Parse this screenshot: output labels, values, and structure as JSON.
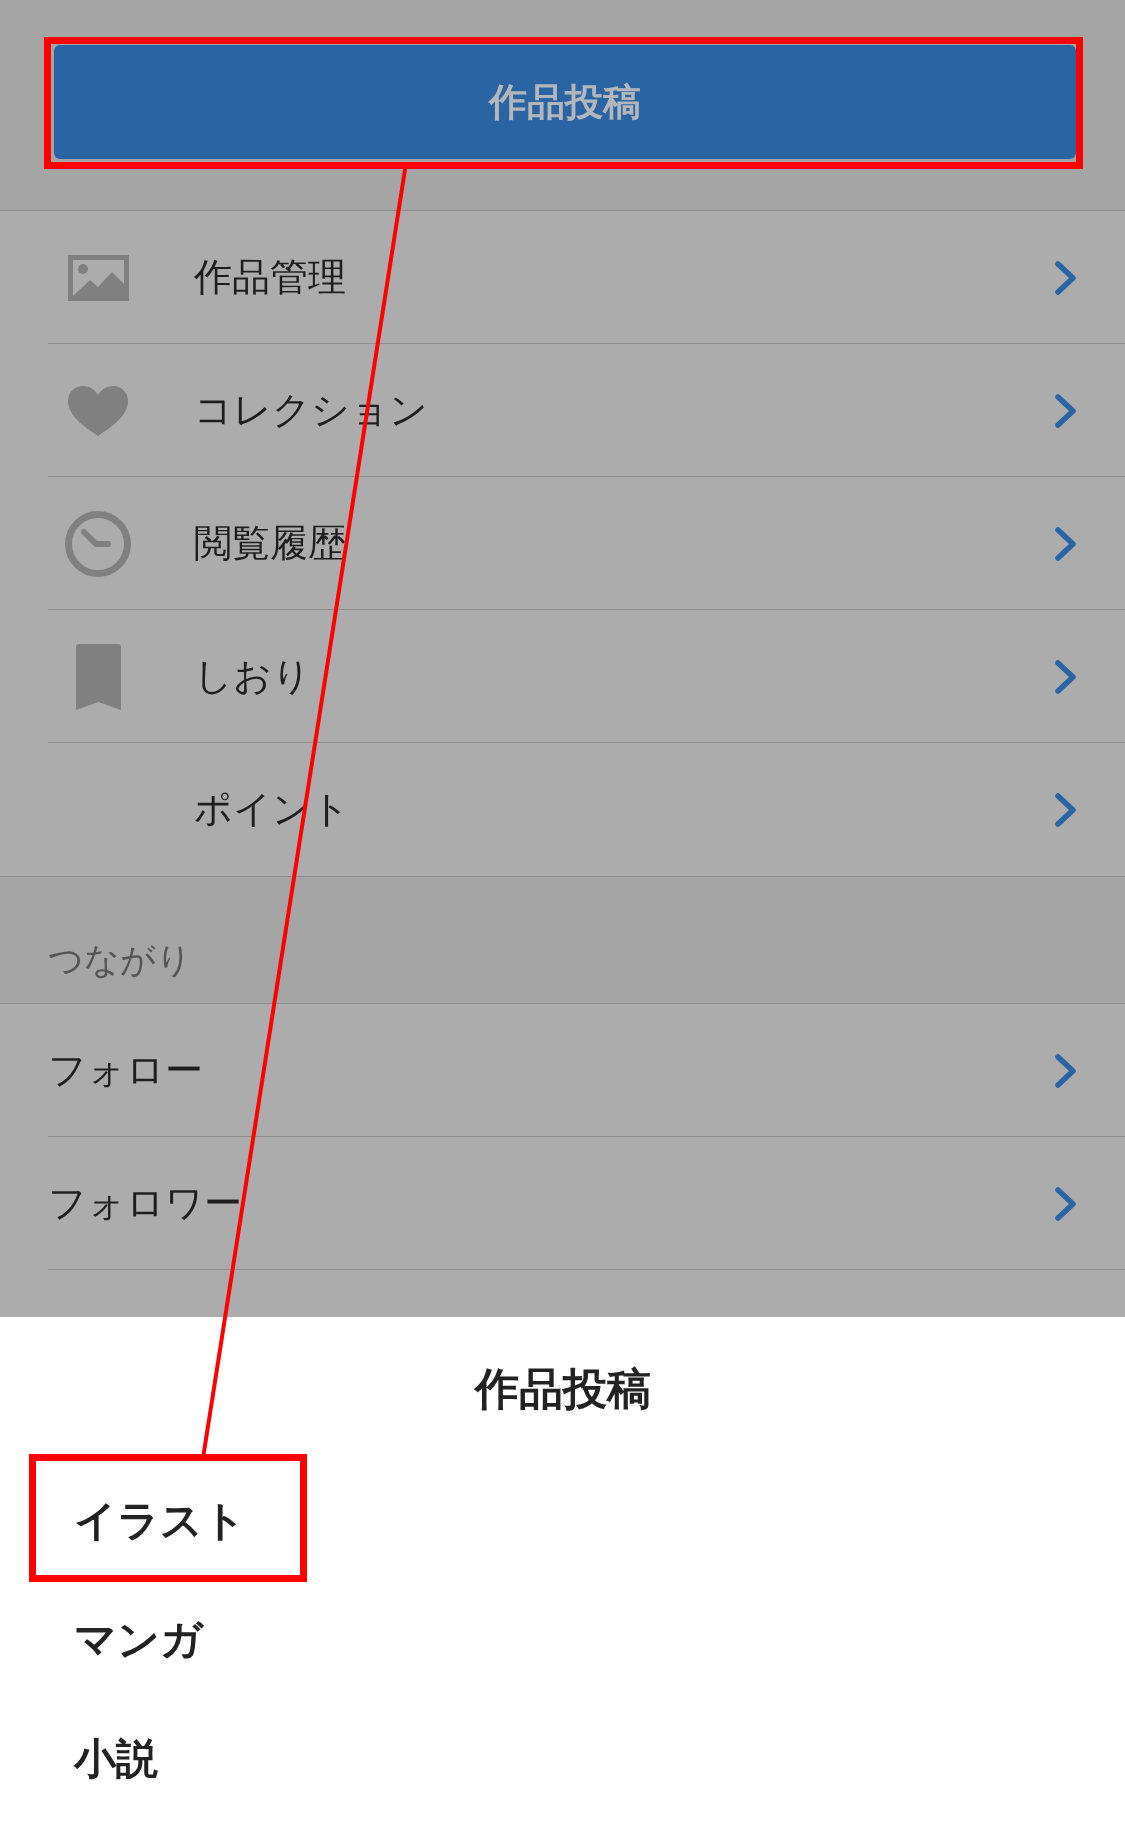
{
  "post_button": {
    "label": "作品投稿",
    "highlighted": true
  },
  "menu": [
    {
      "label": "作品管理"
    },
    {
      "label": "コレクション"
    },
    {
      "label": "閲覧履歴"
    },
    {
      "label": "しおり"
    },
    {
      "label": "ポイント"
    }
  ],
  "connections": {
    "heading": "つながり",
    "items": [
      {
        "label": "フォロー"
      },
      {
        "label": "フォロワー"
      }
    ]
  },
  "sheet": {
    "title": "作品投稿",
    "items": [
      {
        "label": "イラスト",
        "highlighted": true
      },
      {
        "label": "マンガ",
        "highlighted": false
      },
      {
        "label": "小説",
        "highlighted": false
      }
    ]
  }
}
